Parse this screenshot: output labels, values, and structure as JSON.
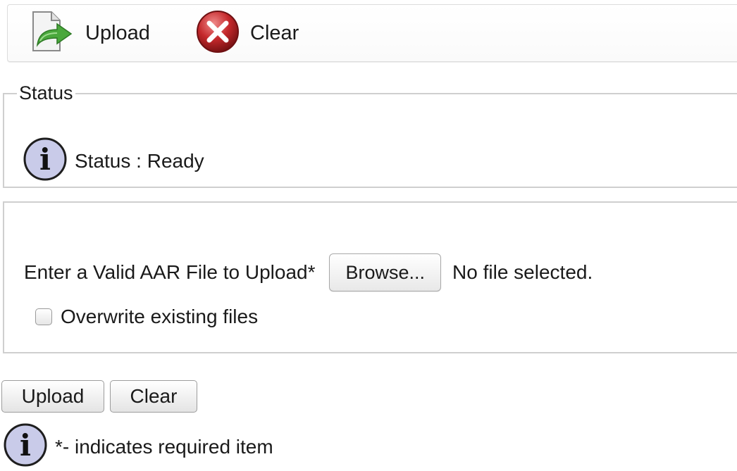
{
  "toolbar": {
    "upload_label": "Upload",
    "upload_icon": "upload-file-icon",
    "clear_label": "Clear",
    "clear_icon": "clear-x-icon"
  },
  "status": {
    "legend": "Status",
    "icon": "info-icon",
    "text": "Status : Ready"
  },
  "upload_form": {
    "file_label": "Enter a Valid AAR File to Upload*",
    "browse_label": "Browse...",
    "file_status": "No file selected.",
    "overwrite_label": "Overwrite existing files",
    "overwrite_checked": false
  },
  "buttons": {
    "upload_label": "Upload",
    "clear_label": "Clear"
  },
  "note": {
    "icon": "info-icon",
    "text": "*- indicates required item"
  },
  "colors": {
    "clear_icon_red": "#c0282a",
    "upload_arrow_green": "#3f9a34",
    "info_icon_fill": "#c9cbe9"
  }
}
